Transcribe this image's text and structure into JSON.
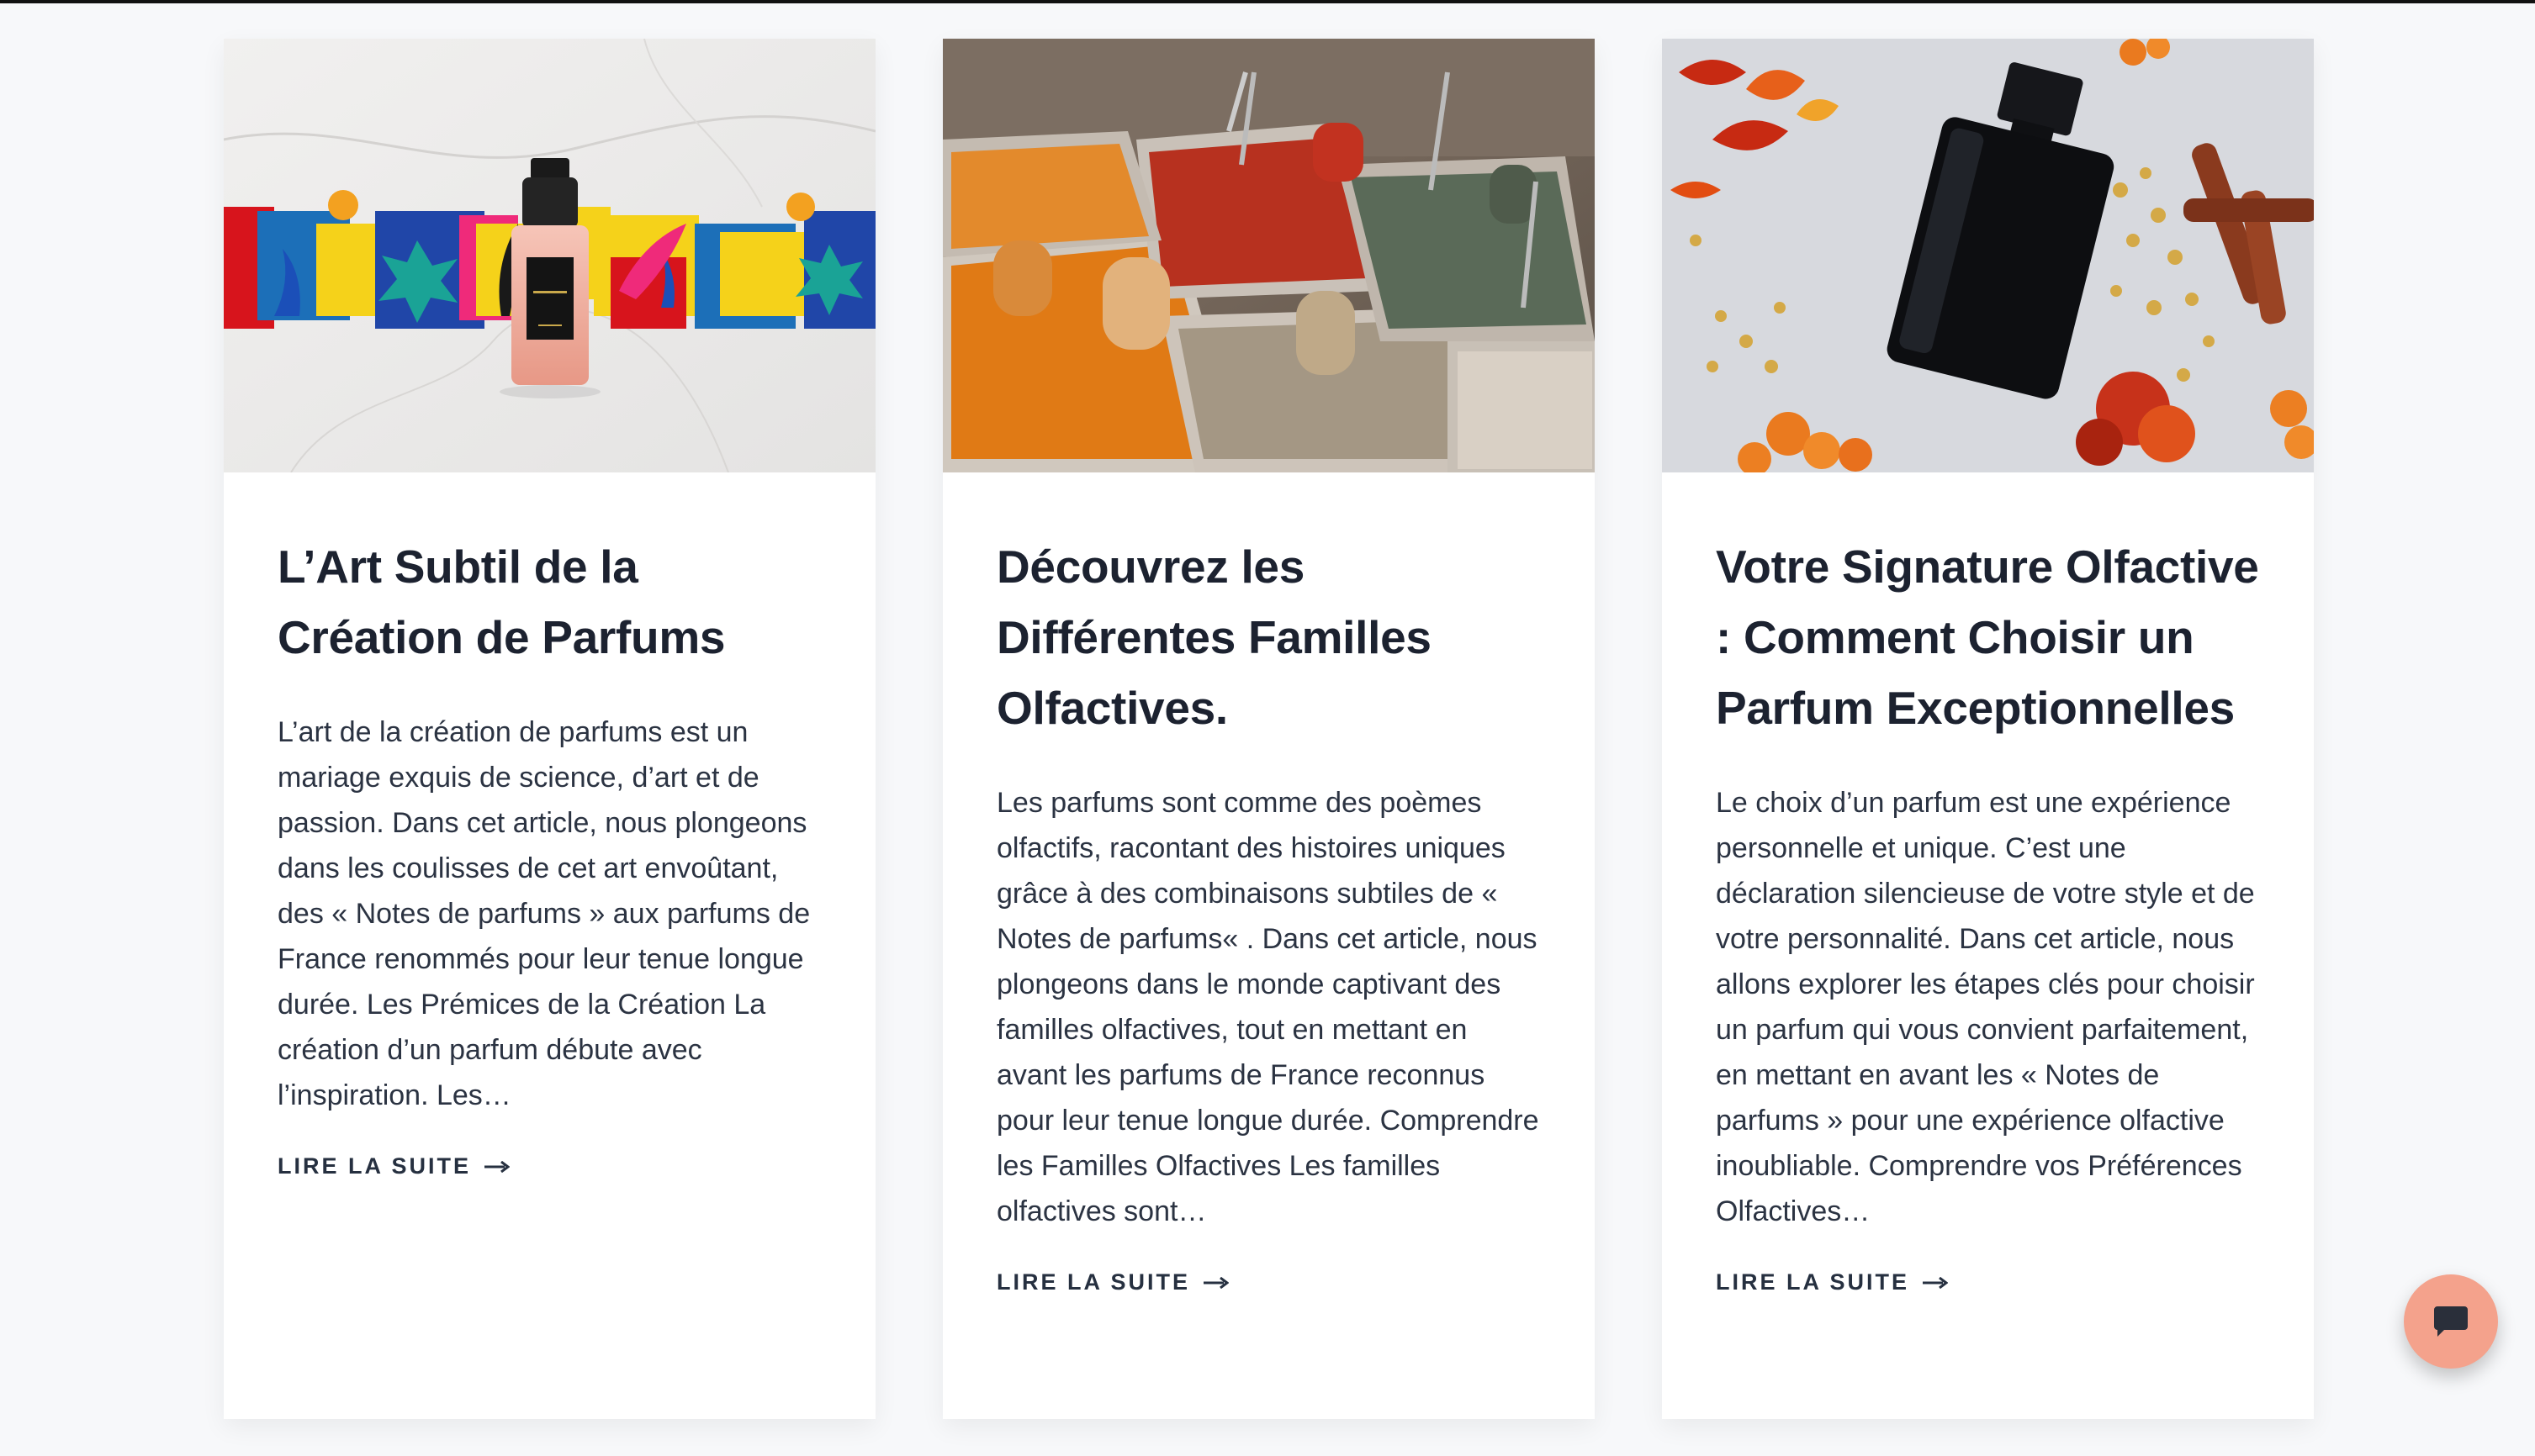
{
  "colors": {
    "page_background": "#f7f8fa",
    "card_background": "#ffffff",
    "title": "#1c2230",
    "text": "#2b3342",
    "chat_button": "#f4a28c"
  },
  "articles": [
    {
      "image_icon": "perfume-bottle-matisse-collage-image",
      "title": "L’Art Subtil de la Création de Parfums",
      "excerpt": "L’art de la création de parfums est un mariage exquis de science, d’art et de passion. Dans cet article, nous plongeons dans les coulisses de cet art envoûtant, des « Notes de parfums » aux parfums de France renommés pour leur tenue longue durée. Les Prémices de la Création La création d’un parfum débute avec l’inspiration. Les…",
      "read_more": "LIRE LA SUITE"
    },
    {
      "image_icon": "spice-market-bins-image",
      "title": "Découvrez les Différentes Familles Olfactives.",
      "excerpt": "Les parfums sont comme des poèmes olfactifs, racontant des histoires uniques grâce à des combinaisons subtiles de « Notes de parfums« . Dans cet article, nous plongeons dans le monde captivant des familles olfactives, tout en mettant en avant les parfums de France reconnus pour leur tenue longue durée. Comprendre les Familles Olfactives Les familles olfactives sont…",
      "read_more": "LIRE LA SUITE"
    },
    {
      "image_icon": "black-perfume-bottle-flowers-image",
      "title": "Votre Signature Olfactive : Comment Choisir un Parfum Exceptionnelles",
      "excerpt": "Le choix d’un parfum est une expérience personnelle et unique. C’est une déclaration silencieuse de votre style et de votre personnalité. Dans cet article, nous allons explorer les étapes clés pour choisir un parfum qui vous convient parfaitement, en mettant en avant les « Notes de parfums » pour une expérience olfactive inoubliable. Comprendre vos Préférences Olfactives…",
      "read_more": "LIRE LA SUITE"
    }
  ],
  "chat": {
    "icon": "chat-bubble-icon"
  }
}
